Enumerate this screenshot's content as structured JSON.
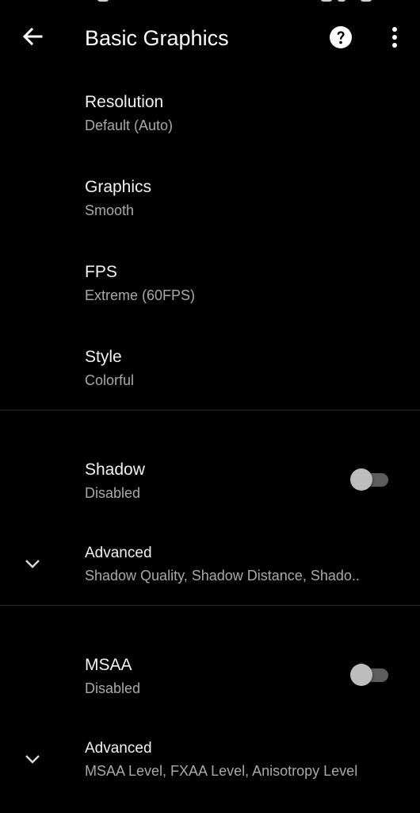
{
  "app_bar": {
    "title": "Basic Graphics",
    "back_icon": "arrow-left-icon",
    "help_icon": "help-circle-icon",
    "more_icon": "more-vert-icon"
  },
  "preferences": {
    "resolution": {
      "title": "Resolution",
      "summary": "Default (Auto)"
    },
    "graphics": {
      "title": "Graphics",
      "summary": "Smooth"
    },
    "fps": {
      "title": "FPS",
      "summary": "Extreme (60FPS)"
    },
    "style": {
      "title": "Style",
      "summary": "Colorful"
    }
  },
  "shadow": {
    "title": "Shadow",
    "summary": "Disabled",
    "enabled": false,
    "advanced": {
      "title": "Advanced",
      "summary": "Shadow Quality, Shadow Distance, Shado.."
    }
  },
  "msaa": {
    "title": "MSAA",
    "summary": "Disabled",
    "enabled": false,
    "advanced": {
      "title": "Advanced",
      "summary": "MSAA Level, FXAA Level, Anisotropy Level"
    }
  },
  "colors": {
    "background": "#000000",
    "title_text": "#ffffff",
    "summary_text": "#a9a9a9",
    "switch_track_off": "#5d5d5d",
    "switch_thumb_off": "#bdbdbd"
  }
}
